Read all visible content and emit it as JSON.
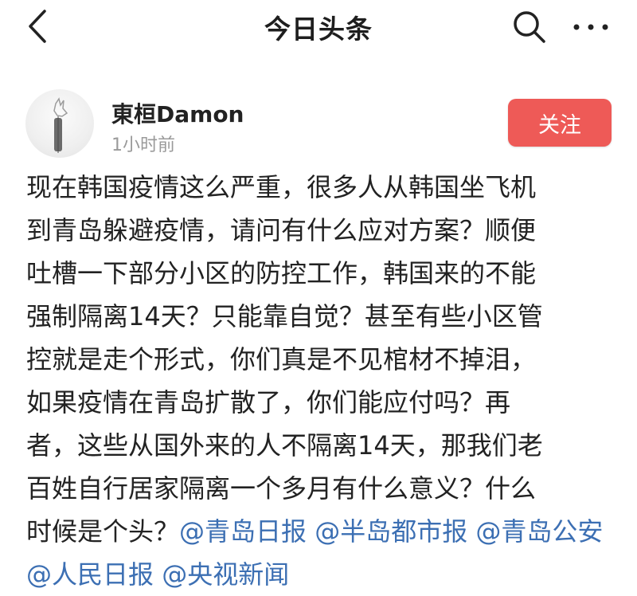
{
  "header": {
    "title": "今日头条",
    "back_icon": "chevron-left-icon",
    "search_icon": "search-icon",
    "more_icon": "more-horizontal-icon"
  },
  "author": {
    "name": "東桓Damon",
    "time": "1小时前",
    "follow_label": "关注"
  },
  "post": {
    "lines": [
      "现在韩国疫情这么严重，很多人从韩国坐飞机",
      "到青岛躲避疫情，请问有什么应对方案？顺便",
      "吐槽一下部分小区的防控工作，韩国来的不能",
      "强制隔离14天？只能靠自觉？甚至有些小区管",
      "控就是走个形式，你们真是不见棺材不掉泪，",
      "如果疫情在青岛扩散了，你们能应付吗？再",
      "者，这些从国外来的人不隔离14天，那我们老",
      "百姓自行居家隔离一个多月有什么意义？什么"
    ],
    "line9_prefix": "时候是个头？",
    "mentions": [
      "@青岛日报",
      "@半岛都市报",
      "@青岛公安",
      "@人民日报",
      "@央视新闻"
    ]
  },
  "colors": {
    "follow_button": "#ee5a57",
    "mention": "#3c6fb3",
    "time_text": "#9a9a9a"
  }
}
